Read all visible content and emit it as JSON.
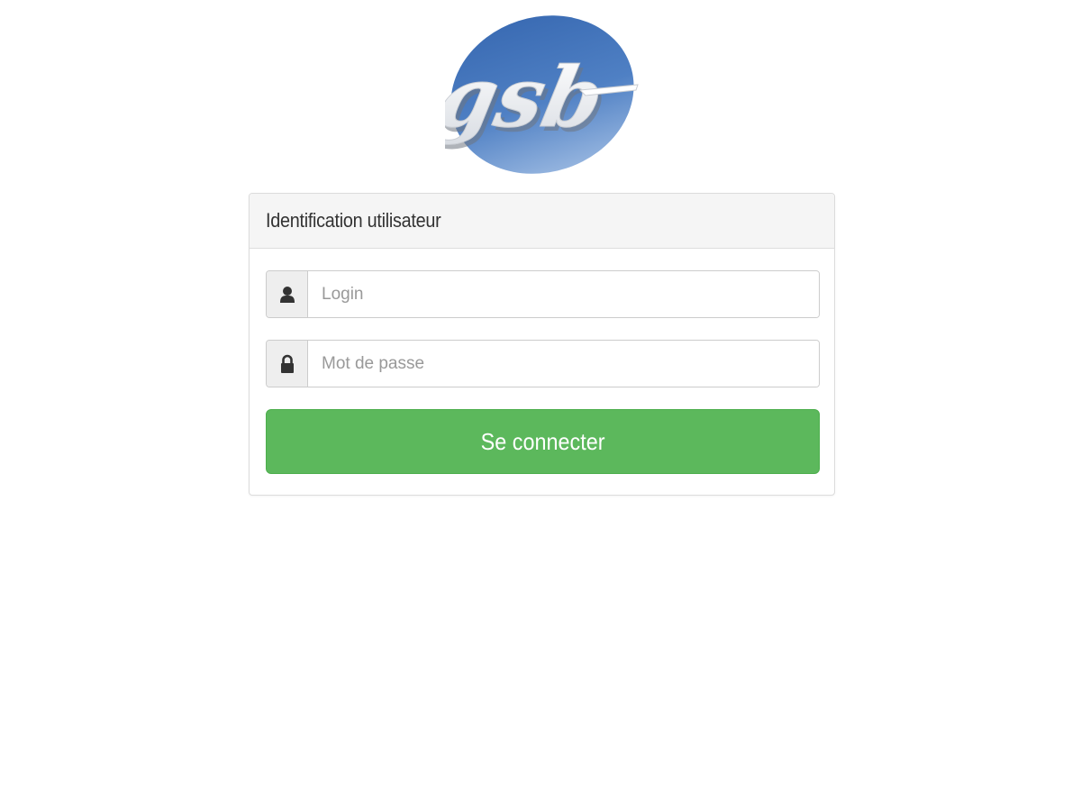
{
  "logo": {
    "text": "gsb",
    "color_dark": "#3f6fb5",
    "color_light": "#8fb0dc"
  },
  "login_panel": {
    "title": "Identification utilisateur",
    "login": {
      "icon": "user-icon",
      "placeholder": "Login",
      "value": ""
    },
    "password": {
      "icon": "lock-icon",
      "placeholder": "Mot de passe",
      "value": ""
    },
    "submit_label": "Se connecter",
    "submit_color": "#5cb85c"
  }
}
